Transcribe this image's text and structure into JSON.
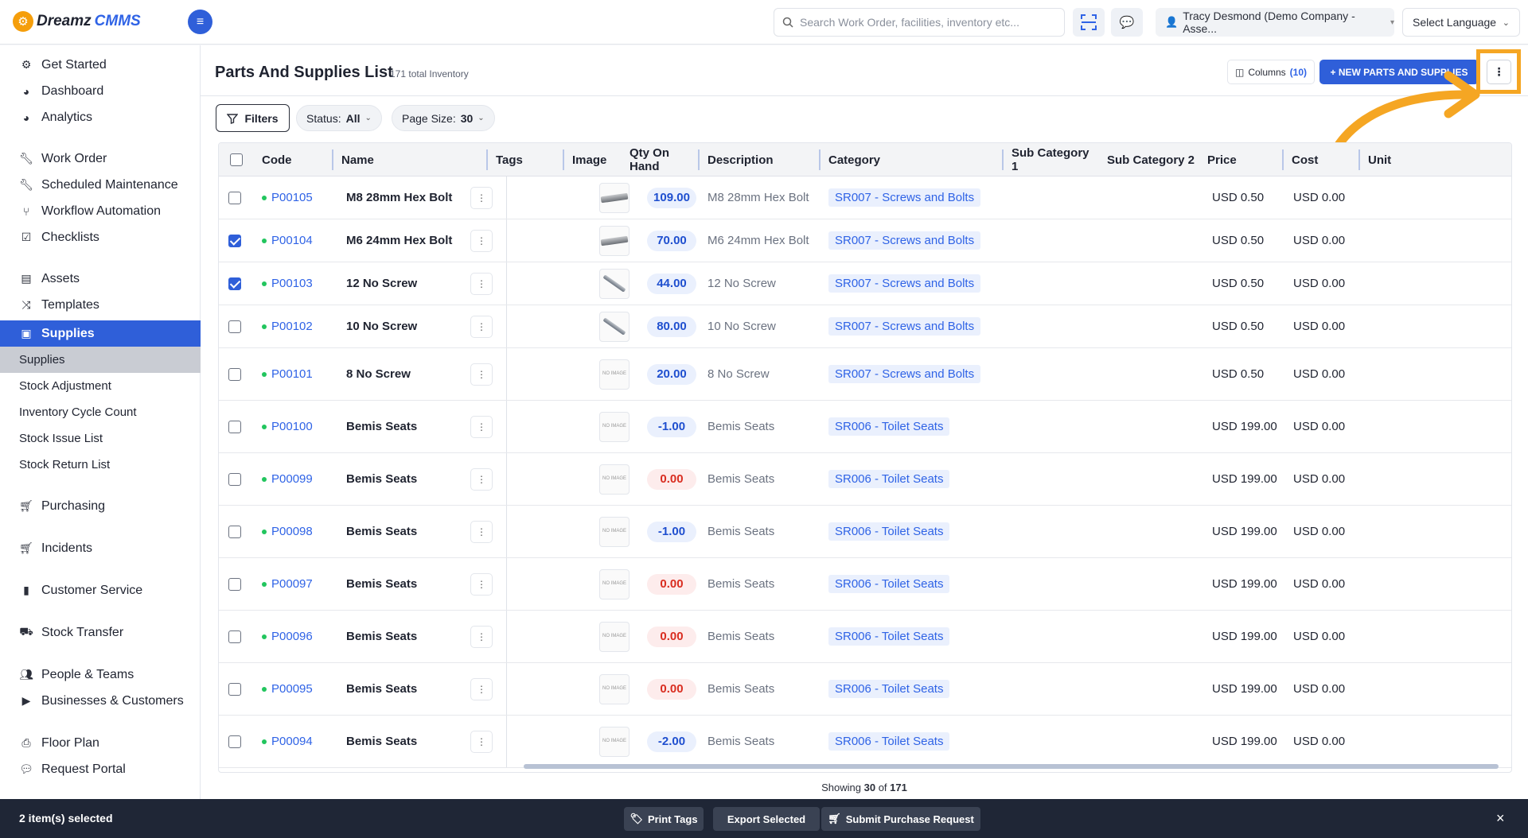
{
  "header": {
    "logo_part1": "Dreamz",
    "logo_part2": "CMMS",
    "search_placeholder": "Search Work Order, facilities, inventory etc...",
    "user_label": "Tracy Desmond (Demo Company - Asse...",
    "language_label": "Select Language"
  },
  "sidebar": {
    "items": [
      {
        "label": "Get Started",
        "icon": "rocket-icon"
      },
      {
        "label": "Dashboard",
        "icon": "dashboard-icon"
      },
      {
        "label": "Analytics",
        "icon": "analytics-icon"
      },
      {
        "label": "Work Order",
        "icon": "wrench-icon"
      },
      {
        "label": "Scheduled Maintenance",
        "icon": "wrench-icon"
      },
      {
        "label": "Workflow Automation",
        "icon": "workflow-icon"
      },
      {
        "label": "Checklists",
        "icon": "checkbox-icon"
      },
      {
        "label": "Assets",
        "icon": "box-icon"
      },
      {
        "label": "Templates",
        "icon": "shuffle-icon"
      },
      {
        "label": "Supplies",
        "icon": "toolbox-icon"
      },
      {
        "label": "Purchasing",
        "icon": "cart-icon"
      },
      {
        "label": "Incidents",
        "icon": "cart-icon"
      },
      {
        "label": "Customer Service",
        "icon": "file-icon"
      },
      {
        "label": "Stock Transfer",
        "icon": "truck-icon"
      },
      {
        "label": "People & Teams",
        "icon": "people-icon"
      },
      {
        "label": "Businesses & Customers",
        "icon": "video-icon"
      },
      {
        "label": "Floor Plan",
        "icon": "printer-icon"
      },
      {
        "label": "Request Portal",
        "icon": "chat-icon"
      }
    ],
    "subitems": [
      "Supplies",
      "Stock Adjustment",
      "Inventory Cycle Count",
      "Stock Issue List",
      "Stock Return List"
    ]
  },
  "page": {
    "title": "Parts And Supplies List",
    "count_label": "171 total Inventory",
    "columns_label": "Columns",
    "columns_count": "(10)",
    "new_button": "+ NEW PARTS AND SUPPLIES",
    "filters_label": "Filters",
    "status_label": "Status:",
    "status_value": "All",
    "pagesize_label": "Page Size:",
    "pagesize_value": "30"
  },
  "table": {
    "columns": [
      "Code",
      "Name",
      "Tags",
      "Image",
      "Qty On Hand",
      "Description",
      "Category",
      "Sub Category 1",
      "Sub Category 2",
      "Price",
      "Cost",
      "Unit"
    ],
    "rows": [
      {
        "checked": false,
        "code": "P00105",
        "name": "M8 28mm Hex Bolt",
        "image": "bolt",
        "qty": "109.00",
        "qty_state": "positive",
        "description": "M8 28mm Hex Bolt",
        "category": "SR007 - Screws and Bolts",
        "price": "USD 0.50",
        "cost": "USD 0.00"
      },
      {
        "checked": true,
        "code": "P00104",
        "name": "M6 24mm Hex Bolt",
        "image": "bolt",
        "qty": "70.00",
        "qty_state": "positive",
        "description": "M6 24mm Hex Bolt",
        "category": "SR007 - Screws and Bolts",
        "price": "USD 0.50",
        "cost": "USD 0.00"
      },
      {
        "checked": true,
        "code": "P00103",
        "name": "12 No Screw",
        "image": "screw",
        "qty": "44.00",
        "qty_state": "positive",
        "description": "12 No Screw",
        "category": "SR007 - Screws and Bolts",
        "price": "USD 0.50",
        "cost": "USD 0.00"
      },
      {
        "checked": false,
        "code": "P00102",
        "name": "10 No Screw",
        "image": "screw",
        "qty": "80.00",
        "qty_state": "positive",
        "description": "10 No Screw",
        "category": "SR007 - Screws and Bolts",
        "price": "USD 0.50",
        "cost": "USD 0.00"
      },
      {
        "checked": false,
        "code": "P00101",
        "name": "8 No Screw",
        "image": "none",
        "qty": "20.00",
        "qty_state": "positive",
        "description": "8 No Screw",
        "category": "SR007 - Screws and Bolts",
        "price": "USD 0.50",
        "cost": "USD 0.00"
      },
      {
        "checked": false,
        "code": "P00100",
        "name": "Bemis Seats",
        "image": "none",
        "qty": "-1.00",
        "qty_state": "positive",
        "description": "Bemis Seats",
        "category": "SR006 - Toilet Seats",
        "price": "USD 199.00",
        "cost": "USD 0.00"
      },
      {
        "checked": false,
        "code": "P00099",
        "name": "Bemis Seats",
        "image": "none",
        "qty": "0.00",
        "qty_state": "zero",
        "description": "Bemis Seats",
        "category": "SR006 - Toilet Seats",
        "price": "USD 199.00",
        "cost": "USD 0.00"
      },
      {
        "checked": false,
        "code": "P00098",
        "name": "Bemis Seats",
        "image": "none",
        "qty": "-1.00",
        "qty_state": "positive",
        "description": "Bemis Seats",
        "category": "SR006 - Toilet Seats",
        "price": "USD 199.00",
        "cost": "USD 0.00"
      },
      {
        "checked": false,
        "code": "P00097",
        "name": "Bemis Seats",
        "image": "none",
        "qty": "0.00",
        "qty_state": "zero",
        "description": "Bemis Seats",
        "category": "SR006 - Toilet Seats",
        "price": "USD 199.00",
        "cost": "USD 0.00"
      },
      {
        "checked": false,
        "code": "P00096",
        "name": "Bemis Seats",
        "image": "none",
        "qty": "0.00",
        "qty_state": "zero",
        "description": "Bemis Seats",
        "category": "SR006 - Toilet Seats",
        "price": "USD 199.00",
        "cost": "USD 0.00"
      },
      {
        "checked": false,
        "code": "P00095",
        "name": "Bemis Seats",
        "image": "none",
        "qty": "0.00",
        "qty_state": "zero",
        "description": "Bemis Seats",
        "category": "SR006 - Toilet Seats",
        "price": "USD 199.00",
        "cost": "USD 0.00"
      },
      {
        "checked": false,
        "code": "P00094",
        "name": "Bemis Seats",
        "image": "none",
        "qty": "-2.00",
        "qty_state": "positive",
        "description": "Bemis Seats",
        "category": "SR006 - Toilet Seats",
        "price": "USD 199.00",
        "cost": "USD 0.00"
      }
    ],
    "no_image_label": "NO IMAGE"
  },
  "footer": {
    "showing_prefix": "Showing",
    "showing_count": "30",
    "showing_of": "of",
    "showing_total": "171"
  },
  "actionbar": {
    "selected_label": "2 item(s) selected",
    "print_tags": "Print Tags",
    "export_selected": "Export Selected",
    "submit_purchase": "Submit Purchase Request"
  },
  "colors": {
    "primary": "#2f5fd9",
    "highlight": "#f5a623",
    "status_green": "#22c55e",
    "danger": "#d92d20"
  }
}
